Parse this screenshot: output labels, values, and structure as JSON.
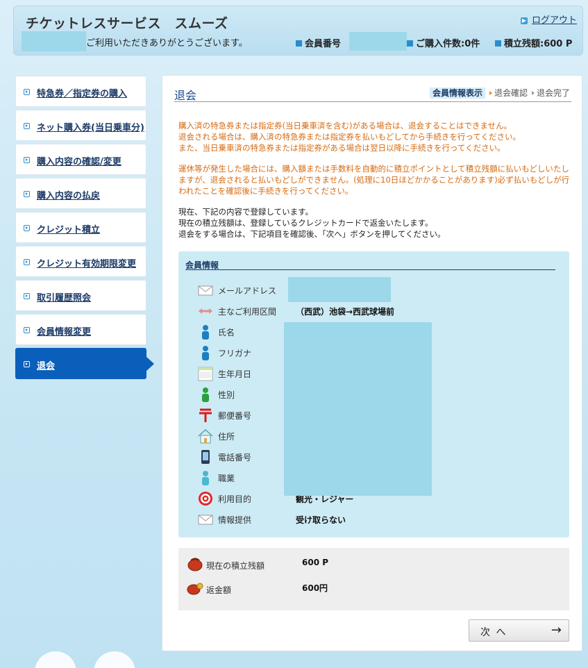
{
  "header": {
    "site_title": "チケットレスサービス　スムーズ",
    "logout": "ログアウト",
    "greeting": "ご利用いただきありがとうございます。",
    "member_no_label": "会員番号",
    "purchase_count": "ご購入件数:0件",
    "balance": "積立残額:600 P"
  },
  "sidebar": {
    "items": [
      {
        "label": "特急券／指定券の購入"
      },
      {
        "label": "ネット購入券(当日乗車分)"
      },
      {
        "label": "購入内容の確認/変更"
      },
      {
        "label": "購入内容の払戻"
      },
      {
        "label": "クレジット積立"
      },
      {
        "label": "クレジット有効期限変更"
      },
      {
        "label": "取引履歴照会"
      },
      {
        "label": "会員情報変更"
      },
      {
        "label": "退会"
      }
    ]
  },
  "main": {
    "title": "退会",
    "steps": [
      "会員情報表示",
      "退会確認",
      "退会完了"
    ],
    "warnings": [
      "購入済の特急券または指定券(当日乗車済を含む)がある場合は、退会することはできません。",
      "退会される場合は、購入済の特急券または指定券を払いもどしてから手続きを行ってください。",
      "また、当日乗車済の特急券または指定券がある場合は翌日以降に手続きを行ってください。",
      "運休等が発生した場合には、購入額または手数料を自動的に積立ポイントとして積立残額に払いもどしいたしますが、退会されると払いもどしができません。(処理に10日ほどかかることがあります)必ず払いもどしが行われたことを確認後に手続きを行ってください。"
    ],
    "info": [
      "現在、下記の内容で登録しています。",
      "現在の積立残額は、登録しているクレジットカードで返金いたします。",
      "退会をする場合は、下記項目を確認後、「次へ」ボタンを押してください。"
    ],
    "member_info": {
      "title": "会員情報",
      "rows": [
        {
          "label": "メールアドレス",
          "value": "",
          "icon": "mail-icon"
        },
        {
          "label": "主なご利用区間",
          "value": "（西武）池袋→西武球場前",
          "icon": "route-arrow-icon"
        },
        {
          "label": "氏名",
          "value": "",
          "icon": "person-icon"
        },
        {
          "label": "フリガナ",
          "value": "",
          "icon": "person-icon"
        },
        {
          "label": "生年月日",
          "value": "",
          "icon": "calendar-icon"
        },
        {
          "label": "性別",
          "value": "",
          "icon": "person-green-icon"
        },
        {
          "label": "郵便番号",
          "value": "",
          "icon": "postal-mark-icon"
        },
        {
          "label": "住所",
          "value": "",
          "icon": "house-icon"
        },
        {
          "label": "電話番号",
          "value": "",
          "icon": "phone-icon"
        },
        {
          "label": "職業",
          "value": "",
          "icon": "person-icon"
        },
        {
          "label": "利用目的",
          "value": "観光・レジャー",
          "icon": "target-icon"
        },
        {
          "label": "情報提供",
          "value": "受け取らない",
          "icon": "mail-icon"
        }
      ]
    },
    "balance_box": {
      "current_label": "現在の積立残額",
      "current_value": "600 P",
      "refund_label": "返金額",
      "refund_value": "600円"
    },
    "next_button": {
      "label": "次 へ",
      "arrow": "→"
    }
  },
  "colors": {
    "accent": "#0a5fba",
    "warning_text": "#d66a10",
    "panel_bg": "#cdebf5",
    "mask": "#9cd8ea"
  }
}
